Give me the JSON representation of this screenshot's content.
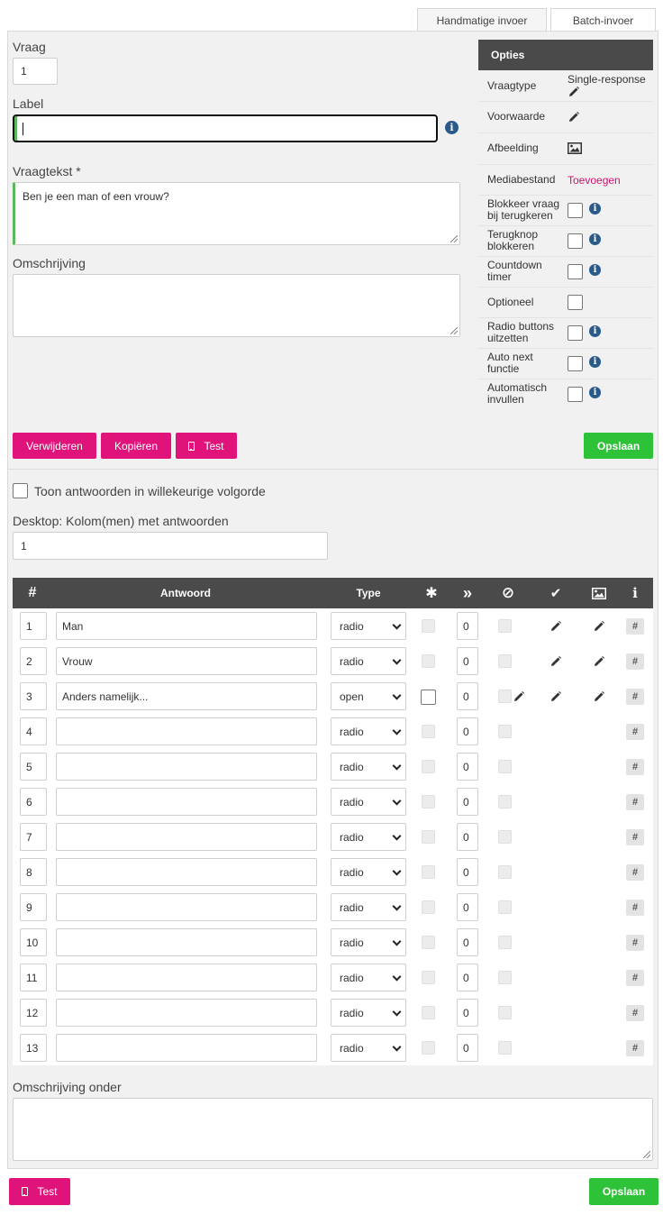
{
  "tabs": [
    {
      "label": "Handmatige invoer",
      "active": true
    },
    {
      "label": "Batch-invoer",
      "active": false
    }
  ],
  "form": {
    "vraag_label": "Vraag",
    "vraag_value": "1",
    "label_label": "Label",
    "label_value": "",
    "vraagtekst_label": "Vraagtekst *",
    "vraagtekst_value": "Ben je een man of een vrouw?",
    "omschrijving_label": "Omschrijving",
    "omschrijving_value": ""
  },
  "options": {
    "header": "Opties",
    "vraagtype_label": "Vraagtype",
    "vraagtype_value": "Single-response",
    "voorwaarde_label": "Voorwaarde",
    "afbeelding_label": "Afbeelding",
    "mediabestand_label": "Mediabestand",
    "mediabestand_link": "Toevoegen",
    "blokkeer_l1": "Blokkeer vraag",
    "blokkeer_l2": "bij terugkeren",
    "terugknop_l1": "Terugknop",
    "terugknop_l2": "blokkeren",
    "countdown_l1": "Countdown",
    "countdown_l2": "timer",
    "optioneel": "Optioneel",
    "radio_l1": "Radio buttons",
    "radio_l2": "uitzetten",
    "autonext_l1": "Auto next",
    "autonext_l2": "functie",
    "autofill_l1": "Automatisch",
    "autofill_l2": "invullen"
  },
  "actions": {
    "verwijderen": "Verwijderen",
    "kopieren": "Kopiëren",
    "test": "Test",
    "opslaan": "Opslaan"
  },
  "settings": {
    "random_label": "Toon antwoorden in willekeurige volgorde",
    "columns_label": "Desktop: Kolom(men) met antwoorden",
    "columns_value": "1"
  },
  "table": {
    "headers": {
      "num": "#",
      "antwoord": "Antwoord",
      "type": "Type",
      "required": "✱",
      "skip": "»",
      "exclusive": "⊘",
      "check": "✔",
      "info": "i"
    },
    "rows": [
      {
        "num": "1",
        "answer": "Man",
        "type": "radio",
        "skip": "0"
      },
      {
        "num": "2",
        "answer": "Vrouw",
        "type": "radio",
        "skip": "0"
      },
      {
        "num": "3",
        "answer": "Anders namelijk...",
        "type": "open",
        "skip": "0"
      },
      {
        "num": "4",
        "answer": "",
        "type": "radio",
        "skip": "0"
      },
      {
        "num": "5",
        "answer": "",
        "type": "radio",
        "skip": "0"
      },
      {
        "num": "6",
        "answer": "",
        "type": "radio",
        "skip": "0"
      },
      {
        "num": "7",
        "answer": "",
        "type": "radio",
        "skip": "0"
      },
      {
        "num": "8",
        "answer": "",
        "type": "radio",
        "skip": "0"
      },
      {
        "num": "9",
        "answer": "",
        "type": "radio",
        "skip": "0"
      },
      {
        "num": "10",
        "answer": "",
        "type": "radio",
        "skip": "0"
      },
      {
        "num": "11",
        "answer": "",
        "type": "radio",
        "skip": "0"
      },
      {
        "num": "12",
        "answer": "",
        "type": "radio",
        "skip": "0"
      },
      {
        "num": "13",
        "answer": "",
        "type": "radio",
        "skip": "0"
      }
    ],
    "hash_label": "#"
  },
  "bottom": {
    "omschrijving_onder_label": "Omschrijving onder",
    "omschrijving_onder_value": "",
    "test": "Test",
    "opslaan": "Opslaan"
  },
  "colors": {
    "pink": "#e0137a",
    "green": "#2dc237",
    "header_dark": "#4a4a4a",
    "info_blue": "#2a5a8a",
    "focus_green": "#5cb85c"
  }
}
